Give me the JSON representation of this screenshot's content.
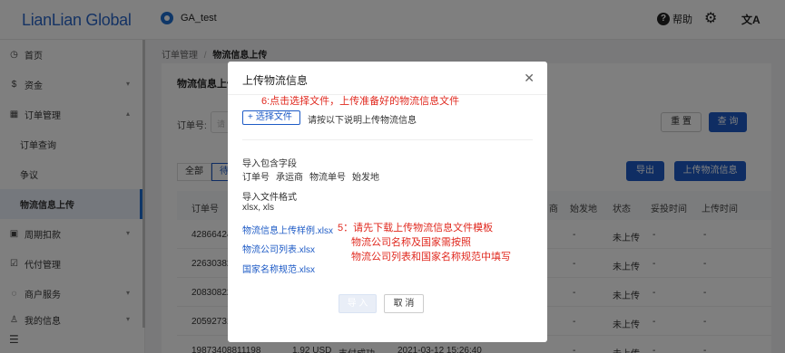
{
  "app": {
    "logo": "LianLian Global",
    "account": "GA_test",
    "help": "帮助",
    "lang_icon": "translate-icon"
  },
  "sidebar": {
    "items": [
      {
        "label": "首页",
        "icon": "clock-icon"
      },
      {
        "label": "资金",
        "icon": "dollar-icon"
      },
      {
        "label": "订单管理",
        "icon": "table-icon"
      },
      {
        "label": "订单查询"
      },
      {
        "label": "争议"
      },
      {
        "label": "物流信息上传"
      },
      {
        "label": "周期扣款",
        "icon": "calendar-icon"
      },
      {
        "label": "代付管理",
        "icon": "checkbox-icon"
      },
      {
        "label": "商户服务",
        "icon": "chat-icon"
      },
      {
        "label": "我的信息",
        "icon": "user-icon"
      }
    ]
  },
  "breadcrumb": {
    "parent": "订单管理",
    "separator": "/",
    "current": "物流信息上传"
  },
  "page": {
    "title": "物流信息上传",
    "order_label": "订单号:",
    "order_placeholder": "请",
    "reset": "重 置",
    "search": "查 询",
    "tabs": [
      "全部",
      "待"
    ],
    "export": "导出",
    "upload": "上传物流信息"
  },
  "table": {
    "headers": [
      "订单号",
      "商",
      "始发地",
      "状态",
      "妥投时间",
      "上传时间"
    ],
    "rows": [
      {
        "id": "42866424",
        "origin": "-",
        "status": "未上传",
        "delivered": "-",
        "uploaded": "-"
      },
      {
        "id": "22630382",
        "origin": "-",
        "status": "未上传",
        "delivered": "-",
        "uploaded": "-"
      },
      {
        "id": "20830822",
        "origin": "-",
        "status": "未上传",
        "delivered": "-",
        "uploaded": "-"
      },
      {
        "id": "20592731",
        "origin": "-",
        "status": "未上传",
        "delivered": "-",
        "uploaded": "-"
      },
      {
        "id": "19873408811198",
        "amount": "1.92 USD",
        "pay": "支付成功",
        "time": "2021-03-12 15:26:40",
        "origin": "-",
        "status": "未上传",
        "delivered": "-",
        "uploaded": "-"
      }
    ]
  },
  "modal": {
    "title": "上传物流信息",
    "note_top": "6:点击选择文件，上传准备好的物流信息文件",
    "choose_btn": "选择文件",
    "choose_hint": "请按以下说明上传物流信息",
    "fields_title": "导入包含字段",
    "fields": [
      "订单号",
      "承运商",
      "物流单号",
      "始发地"
    ],
    "format_title": "导入文件格式",
    "format_value": "xlsx, xls",
    "links": [
      "物流信息上传样例.xlsx",
      "物流公司列表.xlsx",
      "国家名称规范.xlsx"
    ],
    "note_mid_1": "5：请先下载上传物流信息文件模板",
    "note_mid_2": "物流公司名称及国家需按照",
    "note_mid_3": "物流公司列表和国家名称规范中填写",
    "import_btn": "导 入",
    "cancel_btn": "取 消"
  }
}
